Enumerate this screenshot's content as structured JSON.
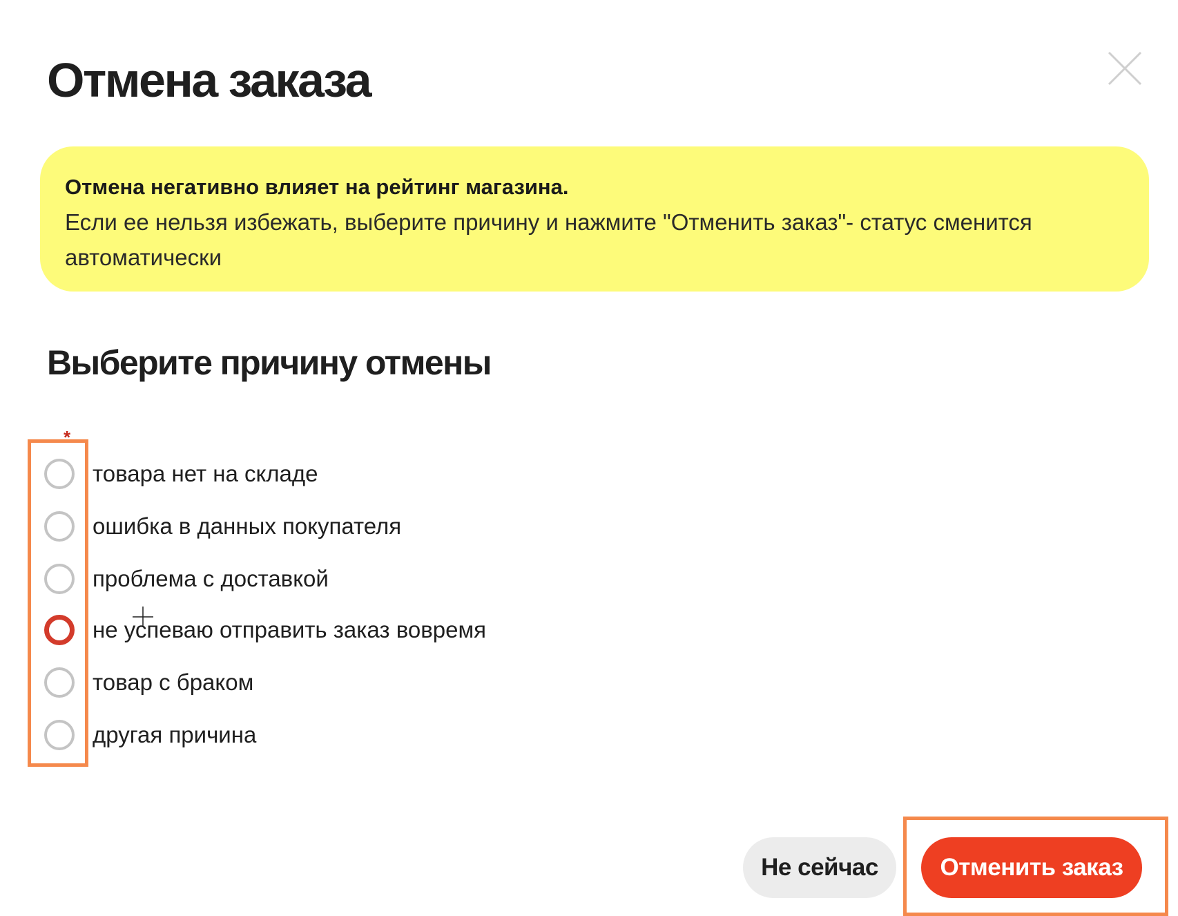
{
  "dialog": {
    "title": "Отмена заказа",
    "close_icon": "close-icon"
  },
  "warning": {
    "strong": "Отмена негативно влияет на рейтинг магазина.",
    "text": "Если ее нельзя избежать, выберите причину и нажмите \"Отменить заказ\"- статус сменится автоматически",
    "background_color": "#fdfb7a"
  },
  "reason": {
    "heading": "Выберите причину отмены",
    "required_mark": "*",
    "options": [
      {
        "label": "товара нет на складе",
        "checked": false
      },
      {
        "label": "ошибка в данных покупателя",
        "checked": false
      },
      {
        "label": "проблема с доставкой",
        "checked": false
      },
      {
        "label": "не успеваю отправить заказ вовремя",
        "checked": true
      },
      {
        "label": "товар с браком",
        "checked": false
      },
      {
        "label": "другая причина",
        "checked": false
      }
    ]
  },
  "actions": {
    "secondary_label": "Не сейчас",
    "primary_label": "Отменить заказ",
    "primary_color": "#ee3f22",
    "highlight_color": "#f5894c"
  }
}
